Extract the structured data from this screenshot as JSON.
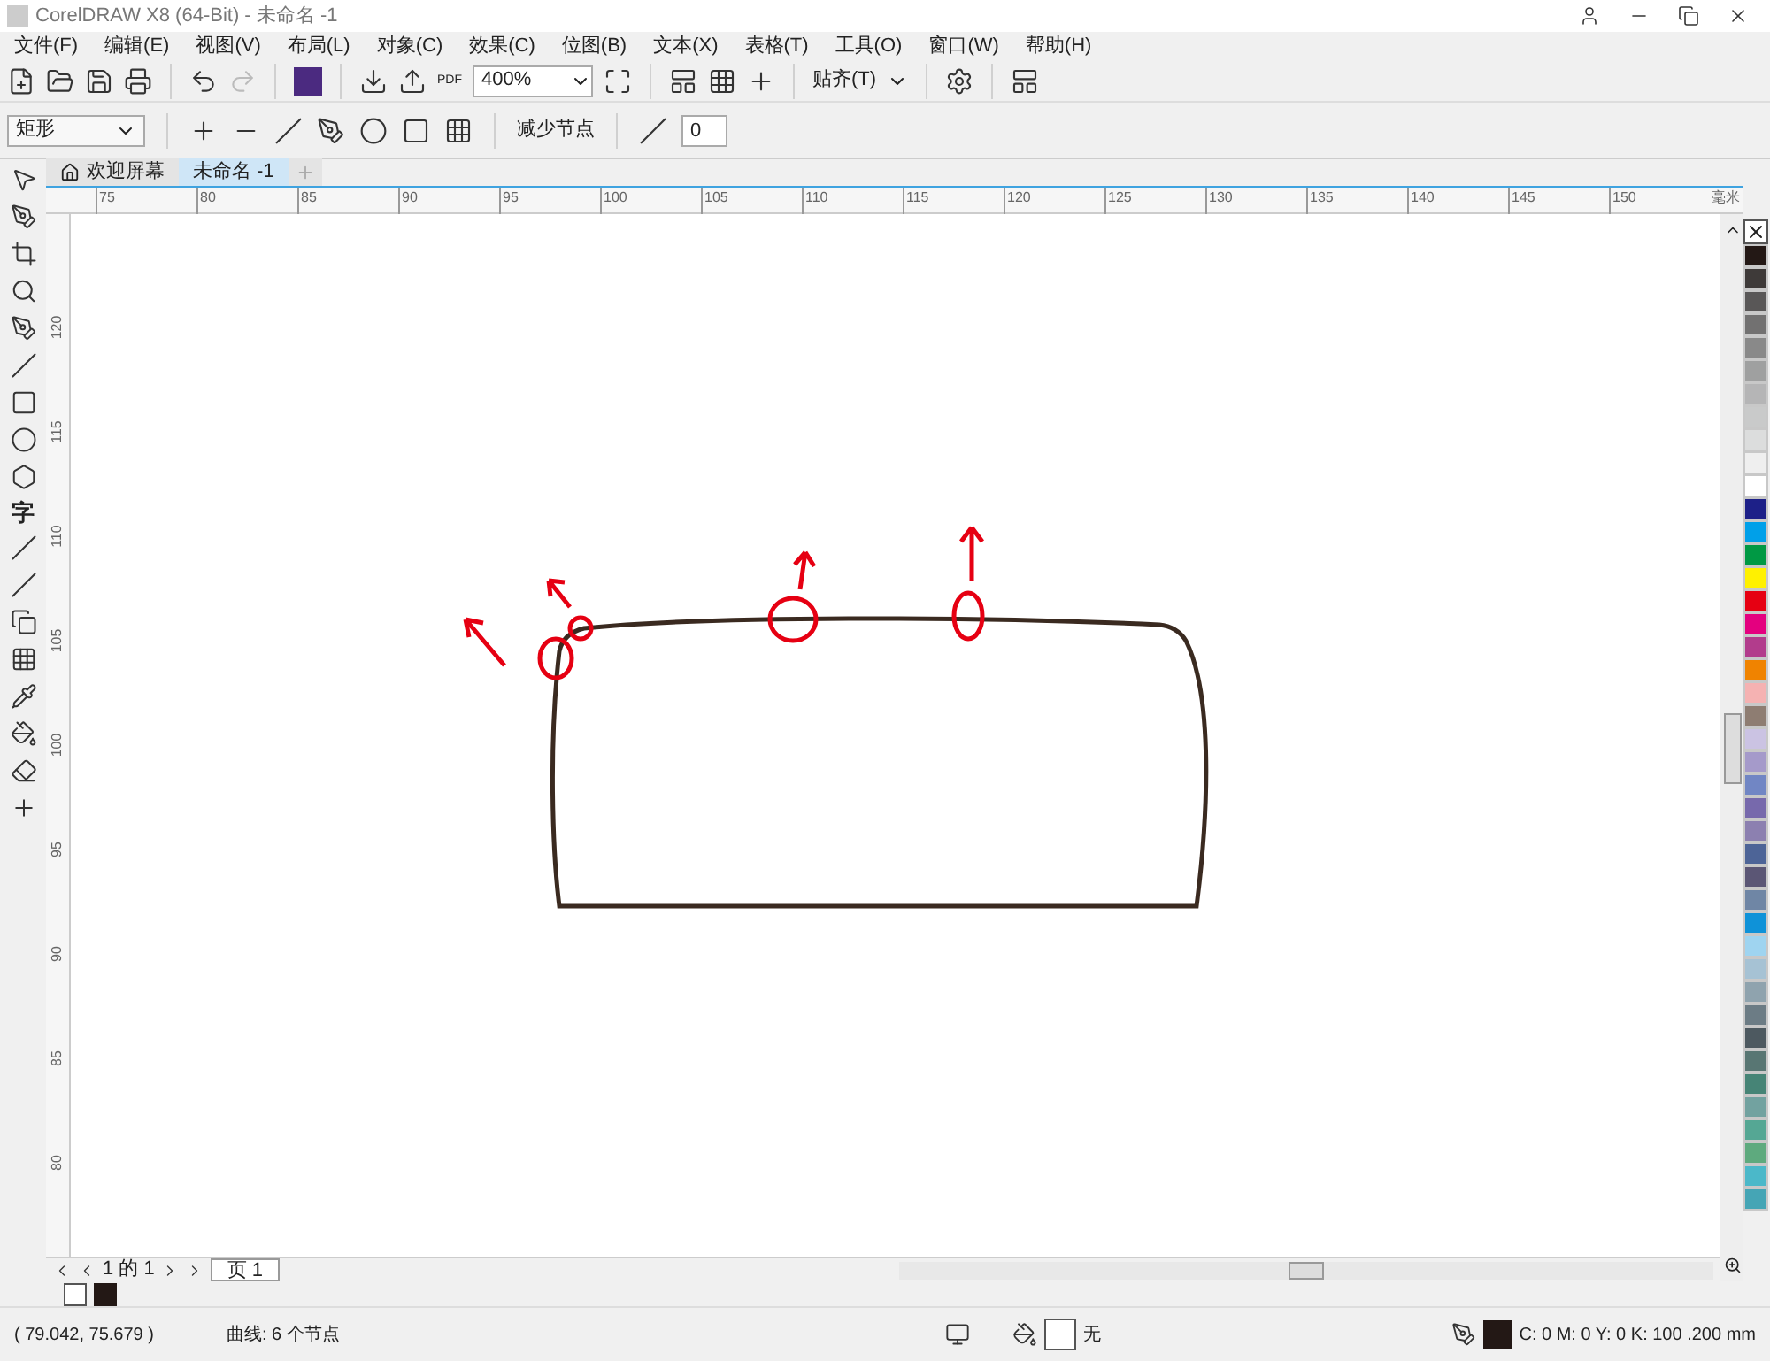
{
  "window": {
    "title": "CorelDRAW X8 (64-Bit) - 未命名 -1"
  },
  "menu": [
    "文件(F)",
    "编辑(E)",
    "视图(V)",
    "布局(L)",
    "对象(C)",
    "效果(C)",
    "位图(B)",
    "文本(X)",
    "表格(T)",
    "工具(O)",
    "窗口(W)",
    "帮助(H)"
  ],
  "toolbar": {
    "pdf_label": "PDF",
    "zoom": "400%",
    "snap": "贴齐(T)"
  },
  "toolbox": {
    "text_tool": "字"
  },
  "property_bar": {
    "shape": "矩形",
    "reduce_nodes": "减少节点",
    "smoothness": "0"
  },
  "tabs": [
    {
      "label": "欢迎屏幕",
      "selected": false
    },
    {
      "label": "未命名 -1",
      "selected": true
    }
  ],
  "ruler": {
    "horizontal": [
      "75",
      "80",
      "85",
      "90",
      "95",
      "100",
      "105",
      "110",
      "115",
      "120",
      "125",
      "130",
      "135",
      "140",
      "145",
      "150"
    ],
    "unit": "毫米",
    "vertical": [
      "120",
      "115",
      "110",
      "105",
      "100",
      "95",
      "90",
      "85",
      "80"
    ]
  },
  "page_nav": {
    "position": "1 的 1",
    "page_tab": "页 1"
  },
  "palette": [
    {
      "color": "#231815"
    },
    {
      "color": "#3e3a39"
    },
    {
      "color": "#595757"
    },
    {
      "color": "#727171"
    },
    {
      "color": "#898989"
    },
    {
      "color": "#9fa0a0"
    },
    {
      "color": "#b5b5b6"
    },
    {
      "color": "#c9caca"
    },
    {
      "color": "#dcdddd"
    },
    {
      "color": "#efefef"
    },
    {
      "color": "#ffffff"
    },
    {
      "color": "#1d2088"
    },
    {
      "color": "#00a0e9"
    },
    {
      "color": "#009944"
    },
    {
      "color": "#fff100"
    },
    {
      "color": "#e60012"
    },
    {
      "color": "#e4007f"
    },
    {
      "color": "#b23c8c"
    },
    {
      "color": "#f08300"
    },
    {
      "color": "#f5b2b2"
    },
    {
      "color": "#8e7d72"
    },
    {
      "color": "#cbc3e3"
    },
    {
      "color": "#a59aca"
    },
    {
      "color": "#7186c4"
    },
    {
      "color": "#7769ac"
    },
    {
      "color": "#8c80b0"
    },
    {
      "color": "#4d6497"
    },
    {
      "color": "#5b5675"
    },
    {
      "color": "#6f86a5"
    },
    {
      "color": "#0f92d8"
    },
    {
      "color": "#9fd4f0"
    },
    {
      "color": "#a6c2d4"
    },
    {
      "color": "#8fa3ae"
    },
    {
      "color": "#6c7c85"
    },
    {
      "color": "#4d5960"
    },
    {
      "color": "#587673"
    },
    {
      "color": "#468476"
    },
    {
      "color": "#72a2a0"
    },
    {
      "color": "#55a794"
    },
    {
      "color": "#5eaa7e"
    },
    {
      "color": "#4bb8c9"
    },
    {
      "color": "#45a5b5"
    }
  ],
  "status_bar": {
    "coordinates": "( 79.042, 75.679 )",
    "selection": "曲线: 6 个节点",
    "fill": "无",
    "outline": "C: 0 M: 0 Y: 0 K: 100 .200 mm"
  }
}
